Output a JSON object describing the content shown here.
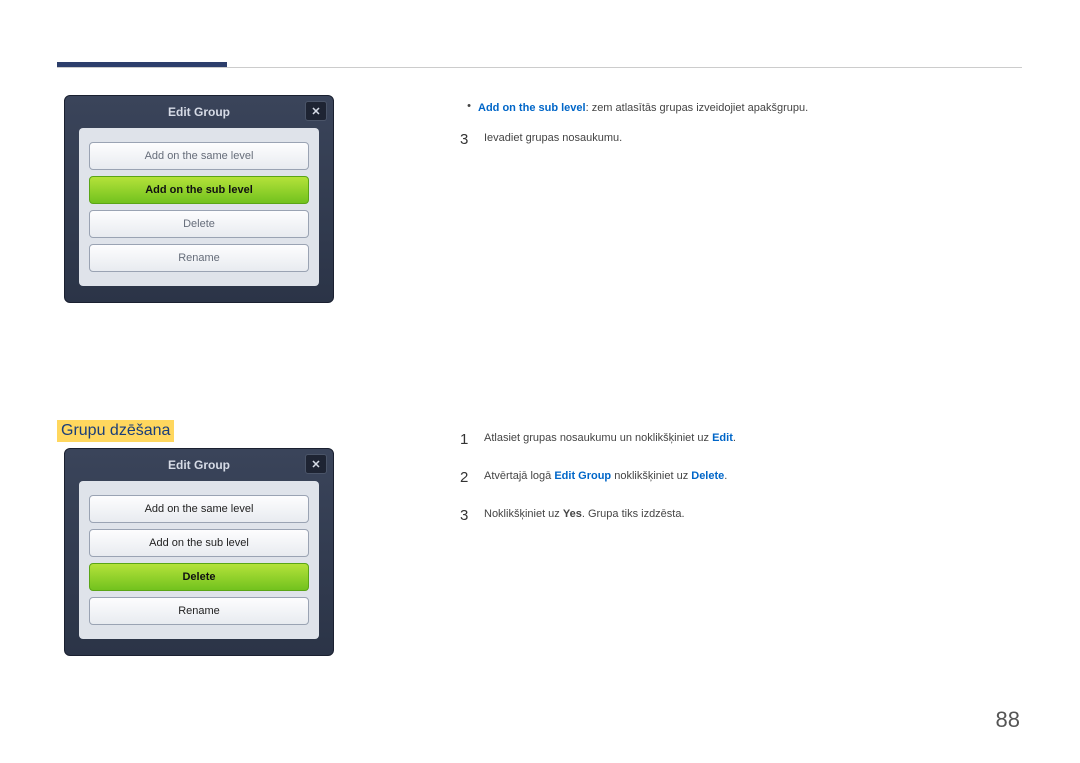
{
  "dialog": {
    "title": "Edit Group",
    "close": "✕",
    "buttons": {
      "same": "Add on the same level",
      "sub": "Add on the sub level",
      "delete": "Delete",
      "rename": "Rename"
    }
  },
  "upper": {
    "bullet_label": "Add on the sub level",
    "bullet_rest": ": zem atlasītās grupas izveidojiet apakšgrupu.",
    "step3_num": "3",
    "step3_text": "Ievadiet grupas nosaukumu."
  },
  "heading": "Grupu dzēšana",
  "lower": {
    "s1_num": "1",
    "s1_a": "Atlasiet grupas nosaukumu un noklikšķiniet uz ",
    "s1_b": "Edit",
    "s1_c": ".",
    "s2_num": "2",
    "s2_a": "Atvērtajā logā ",
    "s2_b": "Edit Group",
    "s2_c": " noklikšķiniet uz ",
    "s2_d": "Delete",
    "s2_e": ".",
    "s3_num": "3",
    "s3_a": "Noklikšķiniet uz ",
    "s3_b": "Yes",
    "s3_c": ". Grupa tiks izdzēsta."
  },
  "page_number": "88"
}
